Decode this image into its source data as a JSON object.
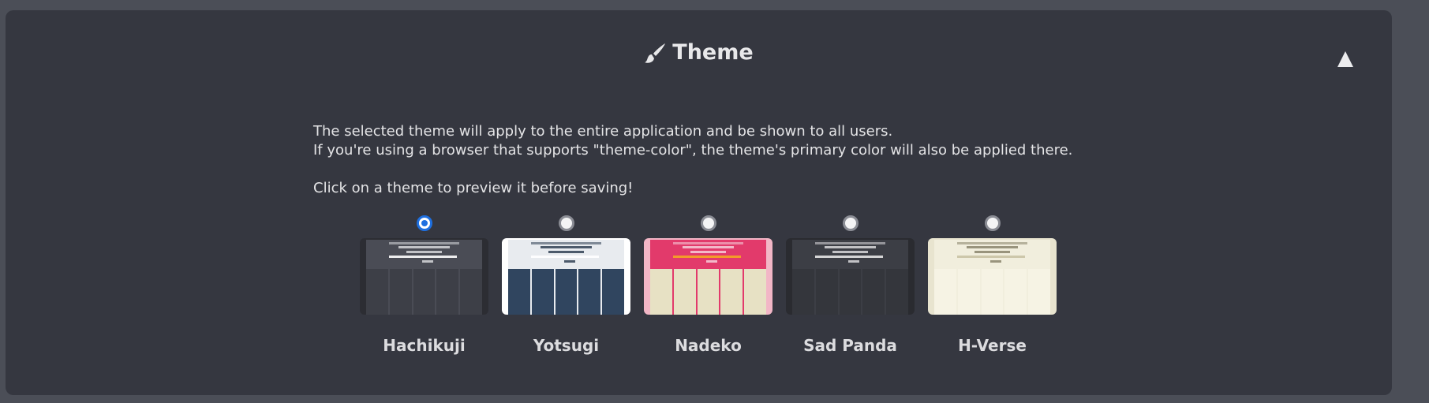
{
  "header": {
    "title": "Theme",
    "icon": "paintbrush-icon"
  },
  "description": {
    "line1": "The selected theme will apply to the entire application and be shown to all users.",
    "line2": "If you're using a browser that supports \"theme-color\", the theme's primary color will also be applied there.",
    "line3": "Click on a theme to preview it before saving!"
  },
  "themes": [
    {
      "label": "Hachikuji",
      "selected": true,
      "frame": "#2c2d33",
      "bg": "#4a4c55",
      "cell": "#3d3f47",
      "bar": "#cfd0d4",
      "accent": "#ffffff"
    },
    {
      "label": "Yotsugi",
      "selected": false,
      "frame": "#ffffff",
      "bg": "#e8ebef",
      "cell": "#30455f",
      "bar": "#3b4a5c",
      "accent": "#ffffff"
    },
    {
      "label": "Nadeko",
      "selected": false,
      "frame": "#f2b6c6",
      "bg": "#e23a6b",
      "cell": "#e7e1c4",
      "bar": "#f5c7d4",
      "accent": "#f5a623"
    },
    {
      "label": "Sad Panda",
      "selected": false,
      "frame": "#2a2b30",
      "bg": "#3c3e45",
      "cell": "#34363c",
      "bar": "#d0d0d3",
      "accent": "#e6e6e6"
    },
    {
      "label": "H-Verse",
      "selected": false,
      "frame": "#e8e4cf",
      "bg": "#f1eedd",
      "cell": "#f6f3e4",
      "bar": "#8f8a72",
      "accent": "#c9c2a4"
    }
  ]
}
